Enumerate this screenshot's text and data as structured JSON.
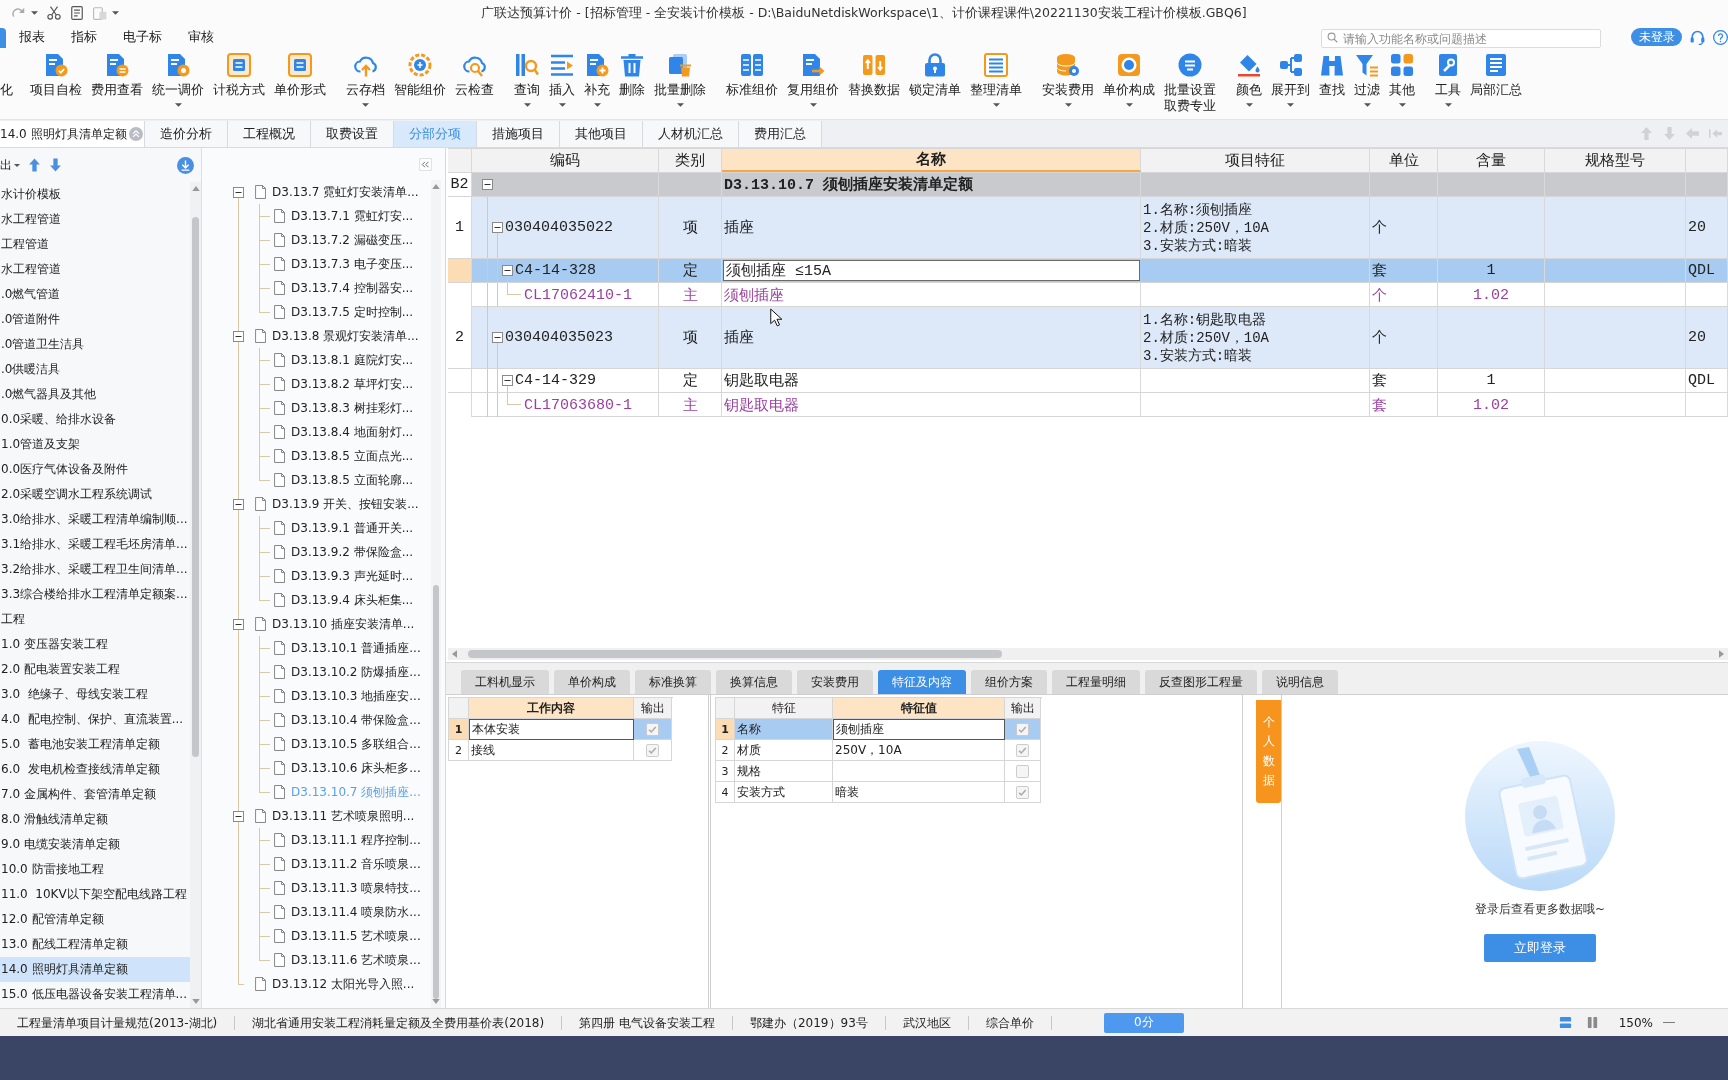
{
  "title_bar": {
    "title": "广联达预算计价 - [招标管理 - 全安装计价模板 - D:\\BaiduNetdiskWorkspace\\1、计价课程课件\\20221130安装工程计价模板.GBQ6]"
  },
  "menu_bar": {
    "items": [
      {
        "label": "报表",
        "selected": false
      },
      {
        "label": "指标",
        "selected": false
      },
      {
        "label": "电子标",
        "selected": false
      },
      {
        "label": "审核",
        "selected": false
      }
    ],
    "search": {
      "placeholder": "请输入功能名称或问题描述"
    },
    "login_button": "未登录"
  },
  "toolbar": {
    "groups": [
      {
        "items": [
          {
            "label": "化",
            "dropdown": false
          }
        ]
      },
      {
        "items": [
          {
            "label": "项目自检",
            "dropdown": false
          },
          {
            "label": "费用查看",
            "dropdown": false
          },
          {
            "label": "统一调价",
            "dropdown": true
          },
          {
            "label": "计税方式",
            "dropdown": false
          },
          {
            "label": "单价形式",
            "dropdown": false
          }
        ]
      },
      {
        "items": [
          {
            "label": "云存档",
            "dropdown": true
          },
          {
            "label": "智能组价",
            "dropdown": false
          },
          {
            "label": "云检查",
            "dropdown": false
          }
        ]
      },
      {
        "items": [
          {
            "label": "查询",
            "dropdown": true
          },
          {
            "label": "插入",
            "dropdown": true
          },
          {
            "label": "补充",
            "dropdown": true
          },
          {
            "label": "删除",
            "dropdown": false
          },
          {
            "label": "批量删除",
            "dropdown": true
          }
        ]
      },
      {
        "items": [
          {
            "label": "标准组价",
            "dropdown": false
          },
          {
            "label": "复用组价",
            "dropdown": true
          },
          {
            "label": "替换数据",
            "dropdown": false
          },
          {
            "label": "锁定清单",
            "dropdown": false
          },
          {
            "label": "整理清单",
            "dropdown": true
          }
        ]
      },
      {
        "items": [
          {
            "label": "安装费用",
            "dropdown": true
          },
          {
            "label": "单价构成",
            "dropdown": true
          },
          {
            "label": "批量设置取费专业",
            "dropdown": false
          }
        ]
      },
      {
        "items": [
          {
            "label": "颜色",
            "dropdown": true
          },
          {
            "label": "展开到",
            "dropdown": true
          },
          {
            "label": "查找",
            "dropdown": false
          },
          {
            "label": "过滤",
            "dropdown": true
          },
          {
            "label": "其他",
            "dropdown": true
          }
        ]
      },
      {
        "items": [
          {
            "label": "工具",
            "dropdown": true
          },
          {
            "label": "局部汇总",
            "dropdown": false
          }
        ]
      }
    ]
  },
  "tab_strip": {
    "project": "14.0 照明灯具清单定额",
    "tabs": [
      {
        "label": "造价分析",
        "selected": false
      },
      {
        "label": "工程概况",
        "selected": false
      },
      {
        "label": "取费设置",
        "selected": false
      },
      {
        "label": "分部分项",
        "selected": true
      },
      {
        "label": "措施项目",
        "selected": false
      },
      {
        "label": "其他项目",
        "selected": false
      },
      {
        "label": "人材机汇总",
        "selected": false
      },
      {
        "label": "费用汇总",
        "selected": false
      }
    ]
  },
  "category_panel": {
    "export_button": "出",
    "items": [
      {
        "label": "水计价模板",
        "selected": false
      },
      {
        "label": "水工程管道",
        "selected": false
      },
      {
        "label": "工程管道",
        "selected": false
      },
      {
        "label": "水工程管道",
        "selected": false
      },
      {
        "label": ".0燃气管道",
        "selected": false
      },
      {
        "label": ".0管道附件",
        "selected": false
      },
      {
        "label": ".0管道卫生洁具",
        "selected": false
      },
      {
        "label": ".0供暖洁具",
        "selected": false
      },
      {
        "label": ".0燃气器具及其他",
        "selected": false
      },
      {
        "label": "0.0采暖、给排水设备",
        "selected": false
      },
      {
        "label": "1.0管道及支架",
        "selected": false
      },
      {
        "label": "0.0医疗气体设备及附件",
        "selected": false
      },
      {
        "label": "2.0采暖空调水工程系统调试",
        "selected": false
      },
      {
        "label": "3.0给排水、采暖工程清单编制顺...",
        "selected": false
      },
      {
        "label": "3.1给排水、采暖工程毛坯房清单...",
        "selected": false
      },
      {
        "label": "3.2给排水、采暖工程卫生间清单...",
        "selected": false
      },
      {
        "label": "3.3综合楼给排水工程清单定额案...",
        "selected": false
      },
      {
        "label": "工程",
        "selected": false
      },
      {
        "label": "1.0 变压器安装工程",
        "selected": false
      },
      {
        "label": "2.0 配电装置安装工程",
        "selected": false
      },
      {
        "label": "3.0  绝缘子、母线安装工程",
        "selected": false
      },
      {
        "label": "4.0  配电控制、保护、直流装置...",
        "selected": false
      },
      {
        "label": "5.0  蓄电池安装工程清单定额",
        "selected": false
      },
      {
        "label": "6.0  发电机检查接线清单定额",
        "selected": false
      },
      {
        "label": "7.0 金属构件、套管清单定额",
        "selected": false
      },
      {
        "label": "8.0 滑触线清单定额",
        "selected": false
      },
      {
        "label": "9.0 电缆安装清单定额",
        "selected": false
      },
      {
        "label": "10.0 防雷接地工程",
        "selected": false
      },
      {
        "label": "11.0  10KV以下架空配电线路工程",
        "selected": false
      },
      {
        "label": "12.0 配管清单定额",
        "selected": false
      },
      {
        "label": "13.0 配线工程清单定额",
        "selected": false
      },
      {
        "label": "14.0 照明灯具清单定额",
        "selected": true
      },
      {
        "label": "15.0 低压电器设备安装工程清单...",
        "selected": false
      }
    ]
  },
  "chapter_tree": {
    "nodes": [
      {
        "label": "D3.13.7 霓虹灯安装清单...",
        "expanded": true,
        "selected": false,
        "children": [
          {
            "label": "D3.13.7.1 霓虹灯安...",
            "selected": false
          },
          {
            "label": "D3.13.7.2 漏磁变压...",
            "selected": false
          },
          {
            "label": "D3.13.7.3 电子变压...",
            "selected": false
          },
          {
            "label": "D3.13.7.4 控制器安...",
            "selected": false
          },
          {
            "label": "D3.13.7.5 定时控制...",
            "selected": false
          }
        ]
      },
      {
        "label": "D3.13.8 景观灯安装清单...",
        "expanded": true,
        "selected": false,
        "children": [
          {
            "label": "D3.13.8.1 庭院灯安...",
            "selected": false
          },
          {
            "label": "D3.13.8.2 草坪灯安...",
            "selected": false
          },
          {
            "label": "D3.13.8.3 树挂彩灯...",
            "selected": false
          },
          {
            "label": "D3.13.8.4 地面射灯...",
            "selected": false
          },
          {
            "label": "D3.13.8.5 立面点光...",
            "selected": false
          },
          {
            "label": "D3.13.8.5 立面轮廓...",
            "selected": false
          }
        ]
      },
      {
        "label": "D3.13.9 开关、按钮安装...",
        "expanded": true,
        "selected": false,
        "children": [
          {
            "label": "D3.13.9.1 普通开关...",
            "selected": false
          },
          {
            "label": "D3.13.9.2 带保险盒...",
            "selected": false
          },
          {
            "label": "D3.13.9.3 声光延时...",
            "selected": false
          },
          {
            "label": "D3.13.9.4 床头柜集...",
            "selected": false
          }
        ]
      },
      {
        "label": "D3.13.10 插座安装清单...",
        "expanded": true,
        "selected": false,
        "children": [
          {
            "label": "D3.13.10.1 普通插座...",
            "selected": false
          },
          {
            "label": "D3.13.10.2 防爆插座...",
            "selected": false
          },
          {
            "label": "D3.13.10.3 地插座安...",
            "selected": false
          },
          {
            "label": "D3.13.10.4 带保险盒...",
            "selected": false
          },
          {
            "label": "D3.13.10.5 多联组合...",
            "selected": false
          },
          {
            "label": "D3.13.10.6 床头柜多...",
            "selected": false
          },
          {
            "label": "D3.13.10.7 须刨插座...",
            "selected": true
          }
        ]
      },
      {
        "label": "D3.13.11 艺术喷泉照明...",
        "expanded": true,
        "selected": false,
        "children": [
          {
            "label": "D3.13.11.1 程序控制...",
            "selected": false
          },
          {
            "label": "D3.13.11.2 音乐喷泉...",
            "selected": false
          },
          {
            "label": "D3.13.11.3 喷泉特技...",
            "selected": false
          },
          {
            "label": "D3.13.11.4 喷泉防水...",
            "selected": false
          },
          {
            "label": "D3.13.11.5 艺术喷泉...",
            "selected": false
          },
          {
            "label": "D3.13.11.6 艺术喷泉...",
            "selected": false
          }
        ]
      },
      {
        "label": "D3.13.12 太阳光导入照...",
        "selected": false
      }
    ]
  },
  "bill_table": {
    "columns": [
      {
        "label": "编码",
        "selected": false
      },
      {
        "label": "类别",
        "selected": false
      },
      {
        "label": "名称",
        "selected": true
      },
      {
        "label": "项目特征",
        "selected": false
      },
      {
        "label": "单位",
        "selected": false
      },
      {
        "label": "含量",
        "selected": false
      },
      {
        "label": "规格型号",
        "selected": false
      }
    ],
    "rows": [
      {
        "kind": "section",
        "number": "B2",
        "expanded": true,
        "selected": false,
        "name": "D3.13.10.7 须刨插座安装清单定额"
      },
      {
        "kind": "bill",
        "number": "1",
        "code": "030404035022",
        "expanded": true,
        "category": "项",
        "name": "插座",
        "features": [
          "1.名称:须刨插座",
          "2.材质:250V，10A",
          "3.安装方式:暗装"
        ],
        "unit": "个",
        "column_9": "20",
        "selected": false
      },
      {
        "kind": "quota",
        "code": "C4-14-328",
        "expanded": true,
        "category": "定",
        "name": "须刨插座 ≤15A",
        "unit": "套",
        "quantity": "1",
        "column_9": "QDL",
        "selected": true
      },
      {
        "kind": "material",
        "code": "CL17062410-1",
        "category": "主",
        "name": "须刨插座",
        "unit": "个",
        "quantity": "1.02",
        "selected": false
      },
      {
        "kind": "bill",
        "number": "2",
        "code": "030404035023",
        "expanded": true,
        "category": "项",
        "name": "插座",
        "features": [
          "1.名称:钥匙取电器",
          "2.材质:250V，10A",
          "3.安装方式:暗装"
        ],
        "unit": "个",
        "column_9": "20",
        "selected": false
      },
      {
        "kind": "quota",
        "code": "C4-14-329",
        "expanded": true,
        "category": "定",
        "name": "钥匙取电器",
        "unit": "套",
        "quantity": "1",
        "column_9": "QDL",
        "selected": false
      },
      {
        "kind": "material",
        "code": "CL17063680-1",
        "category": "主",
        "name": "钥匙取电器",
        "unit": "套",
        "quantity": "1.02",
        "selected": false
      }
    ]
  },
  "detail_panel": {
    "tabs": [
      {
        "label": "工料机显示",
        "selected": false
      },
      {
        "label": "单价构成",
        "selected": false
      },
      {
        "label": "标准换算",
        "selected": false
      },
      {
        "label": "换算信息",
        "selected": false
      },
      {
        "label": "安装费用",
        "selected": false
      },
      {
        "label": "特征及内容",
        "selected": true
      },
      {
        "label": "组价方案",
        "selected": false
      },
      {
        "label": "工程量明细",
        "selected": false
      },
      {
        "label": "反查图形工程量",
        "selected": false
      },
      {
        "label": "说明信息",
        "selected": false
      }
    ],
    "work_table": {
      "columns": [
        {
          "label": "工作内容",
          "selected": true
        },
        {
          "label": "输出",
          "selected": false
        }
      ],
      "rows": [
        {
          "number": "1",
          "content": "本体安装",
          "output": true,
          "selected": true
        },
        {
          "number": "2",
          "content": "接线",
          "output": true,
          "selected": false
        }
      ]
    },
    "feature_table": {
      "columns": [
        {
          "label": "特征",
          "selected": false
        },
        {
          "label": "特征值",
          "selected": true
        },
        {
          "label": "输出",
          "selected": false
        }
      ],
      "rows": [
        {
          "number": "1",
          "feature": "名称",
          "value": "须刨插座",
          "output": true,
          "selected": true
        },
        {
          "number": "2",
          "feature": "材质",
          "value": "250V，10A",
          "output": true,
          "selected": false
        },
        {
          "number": "3",
          "feature": "规格",
          "output": false,
          "selected": false
        },
        {
          "number": "4",
          "feature": "安装方式",
          "value": "暗装",
          "output": true,
          "selected": false
        }
      ]
    },
    "side_tab": "个人数据",
    "login_panel": {
      "message": "登录后查看更多数据哦~",
      "button": "立即登录"
    }
  },
  "status_bar": {
    "items": [
      "工程量清单项目计量规范(2013-湖北)",
      "湖北省通用安装工程消耗量定额及全费用基价表(2018)",
      "第四册 电气设备安装工程",
      "鄂建办（2019）93号",
      "武汉地区",
      "综合单价"
    ],
    "score_button": "0分",
    "views": [
      {
        "selected": true
      },
      {
        "selected": false
      }
    ],
    "zoom": "150%"
  }
}
